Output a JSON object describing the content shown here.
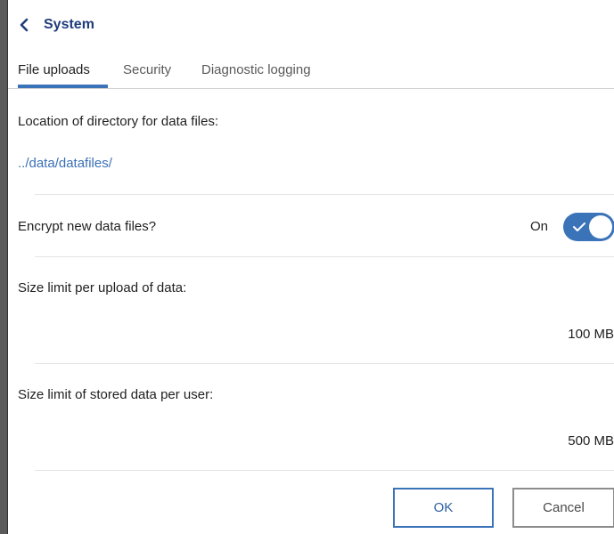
{
  "header": {
    "title": "System"
  },
  "tabs": [
    {
      "label": "File uploads",
      "active": true
    },
    {
      "label": "Security",
      "active": false
    },
    {
      "label": "Diagnostic logging",
      "active": false
    }
  ],
  "settings": {
    "data_dir": {
      "label": "Location of directory for data files:",
      "value": "../data/datafiles/"
    },
    "encrypt": {
      "label": "Encrypt new data files?",
      "state_text": "On",
      "enabled": true
    },
    "upload_limit": {
      "label": "Size limit per upload of data:",
      "value": "100 MB"
    },
    "stored_limit": {
      "label": "Size limit of stored data per user:",
      "value": "500 MB"
    }
  },
  "footer": {
    "ok_label": "OK",
    "cancel_label": "Cancel"
  },
  "colors": {
    "accent": "#3b73b9",
    "title": "#1f3d7a",
    "link": "#3b6fb6"
  },
  "icons": {
    "back": "chevron-left-icon",
    "toggle_check": "check-icon"
  }
}
